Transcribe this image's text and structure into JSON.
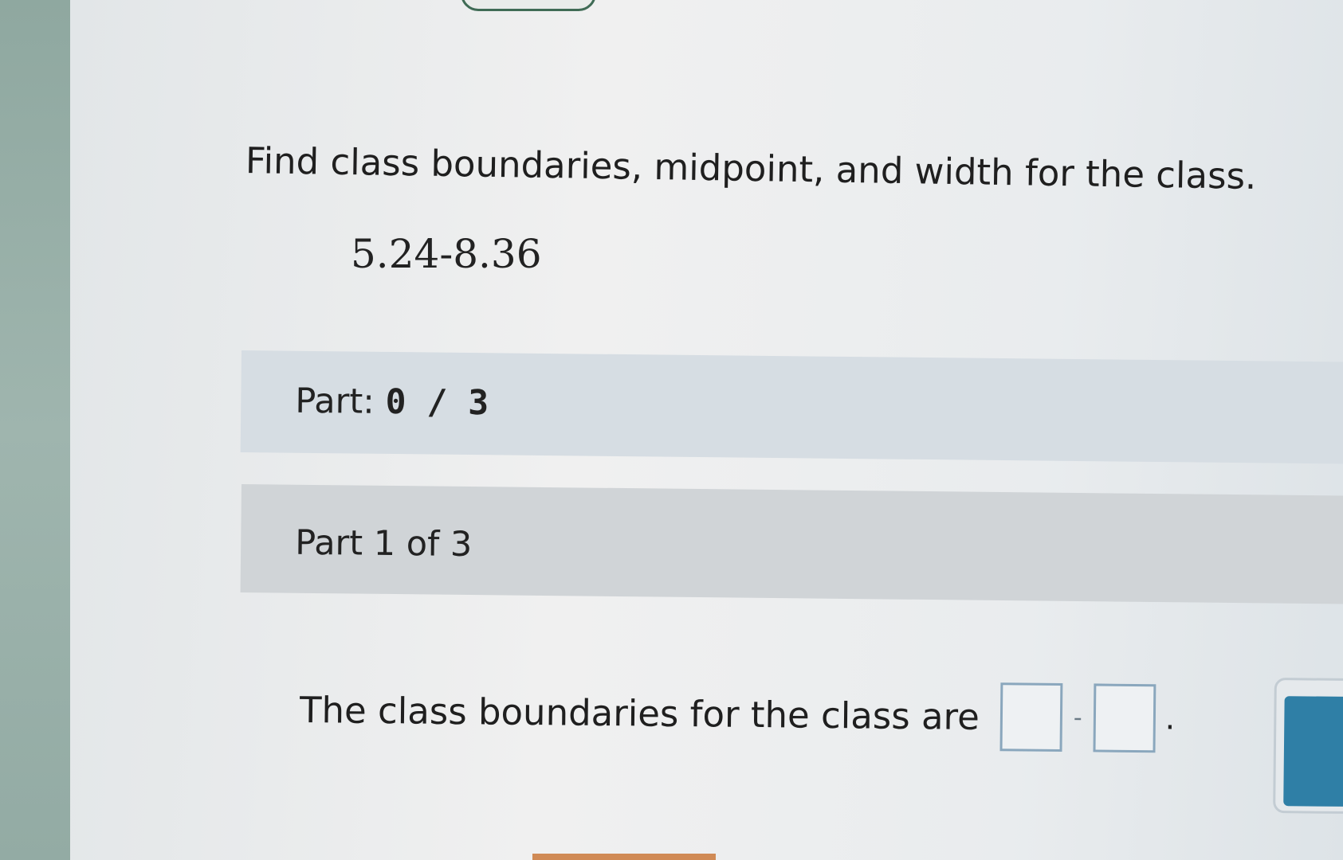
{
  "question": {
    "text": "Find class boundaries, midpoint, and width for the class.",
    "class_range": "5.24-8.36"
  },
  "progress": {
    "label": "Part:",
    "value": "0 / 3",
    "completed": 0,
    "total": 3
  },
  "step": {
    "label": "Part 1 of 3"
  },
  "answer": {
    "prompt": "The class boundaries for the class are",
    "lower_value": "",
    "upper_value": "",
    "separator": "-",
    "end_punctuation": "."
  },
  "actions": {
    "clear_icon": "close-icon"
  },
  "colors": {
    "accent": "#2f7fa6",
    "input_border": "#8aa7bd",
    "progress_bar": "#d6dde3"
  }
}
